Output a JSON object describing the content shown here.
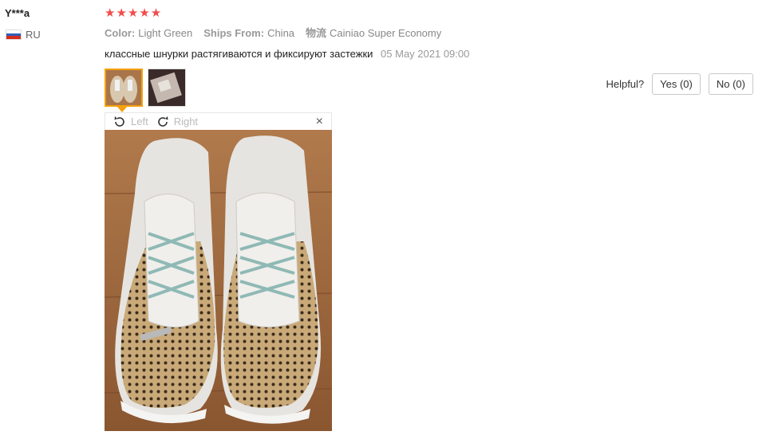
{
  "reviewer": {
    "name": "Y***a",
    "country": "RU"
  },
  "rating": {
    "stars": "★★★★★"
  },
  "meta": {
    "color_label": "Color:",
    "color_value": "Light Green",
    "ships_label": "Ships From:",
    "ships_value": "China",
    "logistics_label": "物流",
    "logistics_value": "Cainiao Super Economy"
  },
  "review": {
    "text": "классные шнурки растягиваются и фиксируют застежки",
    "date": "05 May 2021 09:00"
  },
  "helpful": {
    "label": "Helpful?",
    "yes": "Yes (0)",
    "no": "No (0)"
  },
  "viewer": {
    "rotate_left": "Left",
    "rotate_right": "Right",
    "close": "×"
  },
  "colors": {
    "star": "#f44b4b",
    "active_border": "#f6a00e"
  }
}
